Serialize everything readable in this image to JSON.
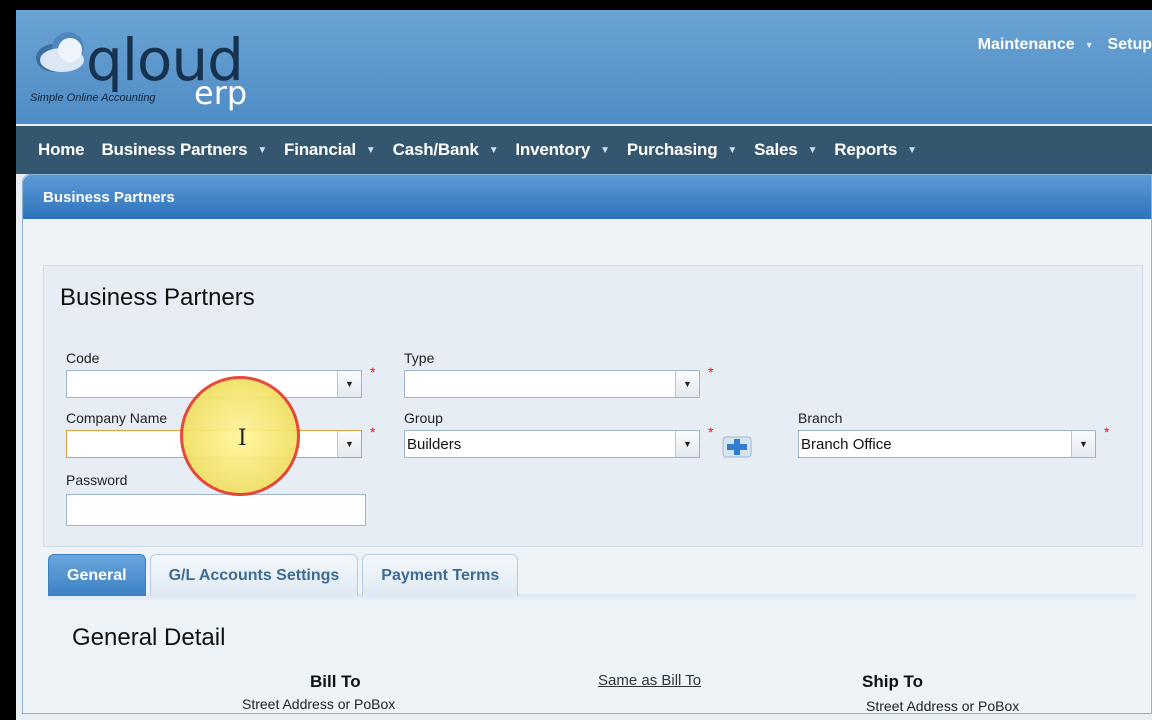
{
  "logo": {
    "brand": "qloud",
    "suffix": "erp",
    "tagline": "Simple Online Accounting"
  },
  "top_links": [
    {
      "label": "Maintenance"
    },
    {
      "label": "Setup"
    }
  ],
  "nav": [
    {
      "label": "Home"
    },
    {
      "label": "Business Partners"
    },
    {
      "label": "Financial"
    },
    {
      "label": "Cash/Bank"
    },
    {
      "label": "Inventory"
    },
    {
      "label": "Purchasing"
    },
    {
      "label": "Sales"
    },
    {
      "label": "Reports"
    }
  ],
  "panel": {
    "title": "Business Partners"
  },
  "form": {
    "title": "Business Partners",
    "code": {
      "label": "Code",
      "value": ""
    },
    "type": {
      "label": "Type",
      "value": ""
    },
    "company_name": {
      "label": "Company Name",
      "value": ""
    },
    "group": {
      "label": "Group",
      "value": "Builders"
    },
    "branch": {
      "label": "Branch",
      "value": "Branch Office"
    },
    "password": {
      "label": "Password",
      "value": ""
    },
    "required_mark": "*"
  },
  "tabs": [
    {
      "label": "General",
      "active": true
    },
    {
      "label": "G/L Accounts Settings",
      "active": false
    },
    {
      "label": "Payment Terms",
      "active": false
    }
  ],
  "general": {
    "title": "General Detail",
    "bill_to": "Bill To",
    "same_as_bill_to": "Same as Bill To",
    "ship_to": "Ship To",
    "street_label_bill": "Street Address or PoBox",
    "street_label_ship": "Street Address or PoBox"
  },
  "colors": {
    "header": "#5a96cc",
    "nav": "#34566e",
    "accent": "#3c80c4",
    "required": "#e11111"
  }
}
